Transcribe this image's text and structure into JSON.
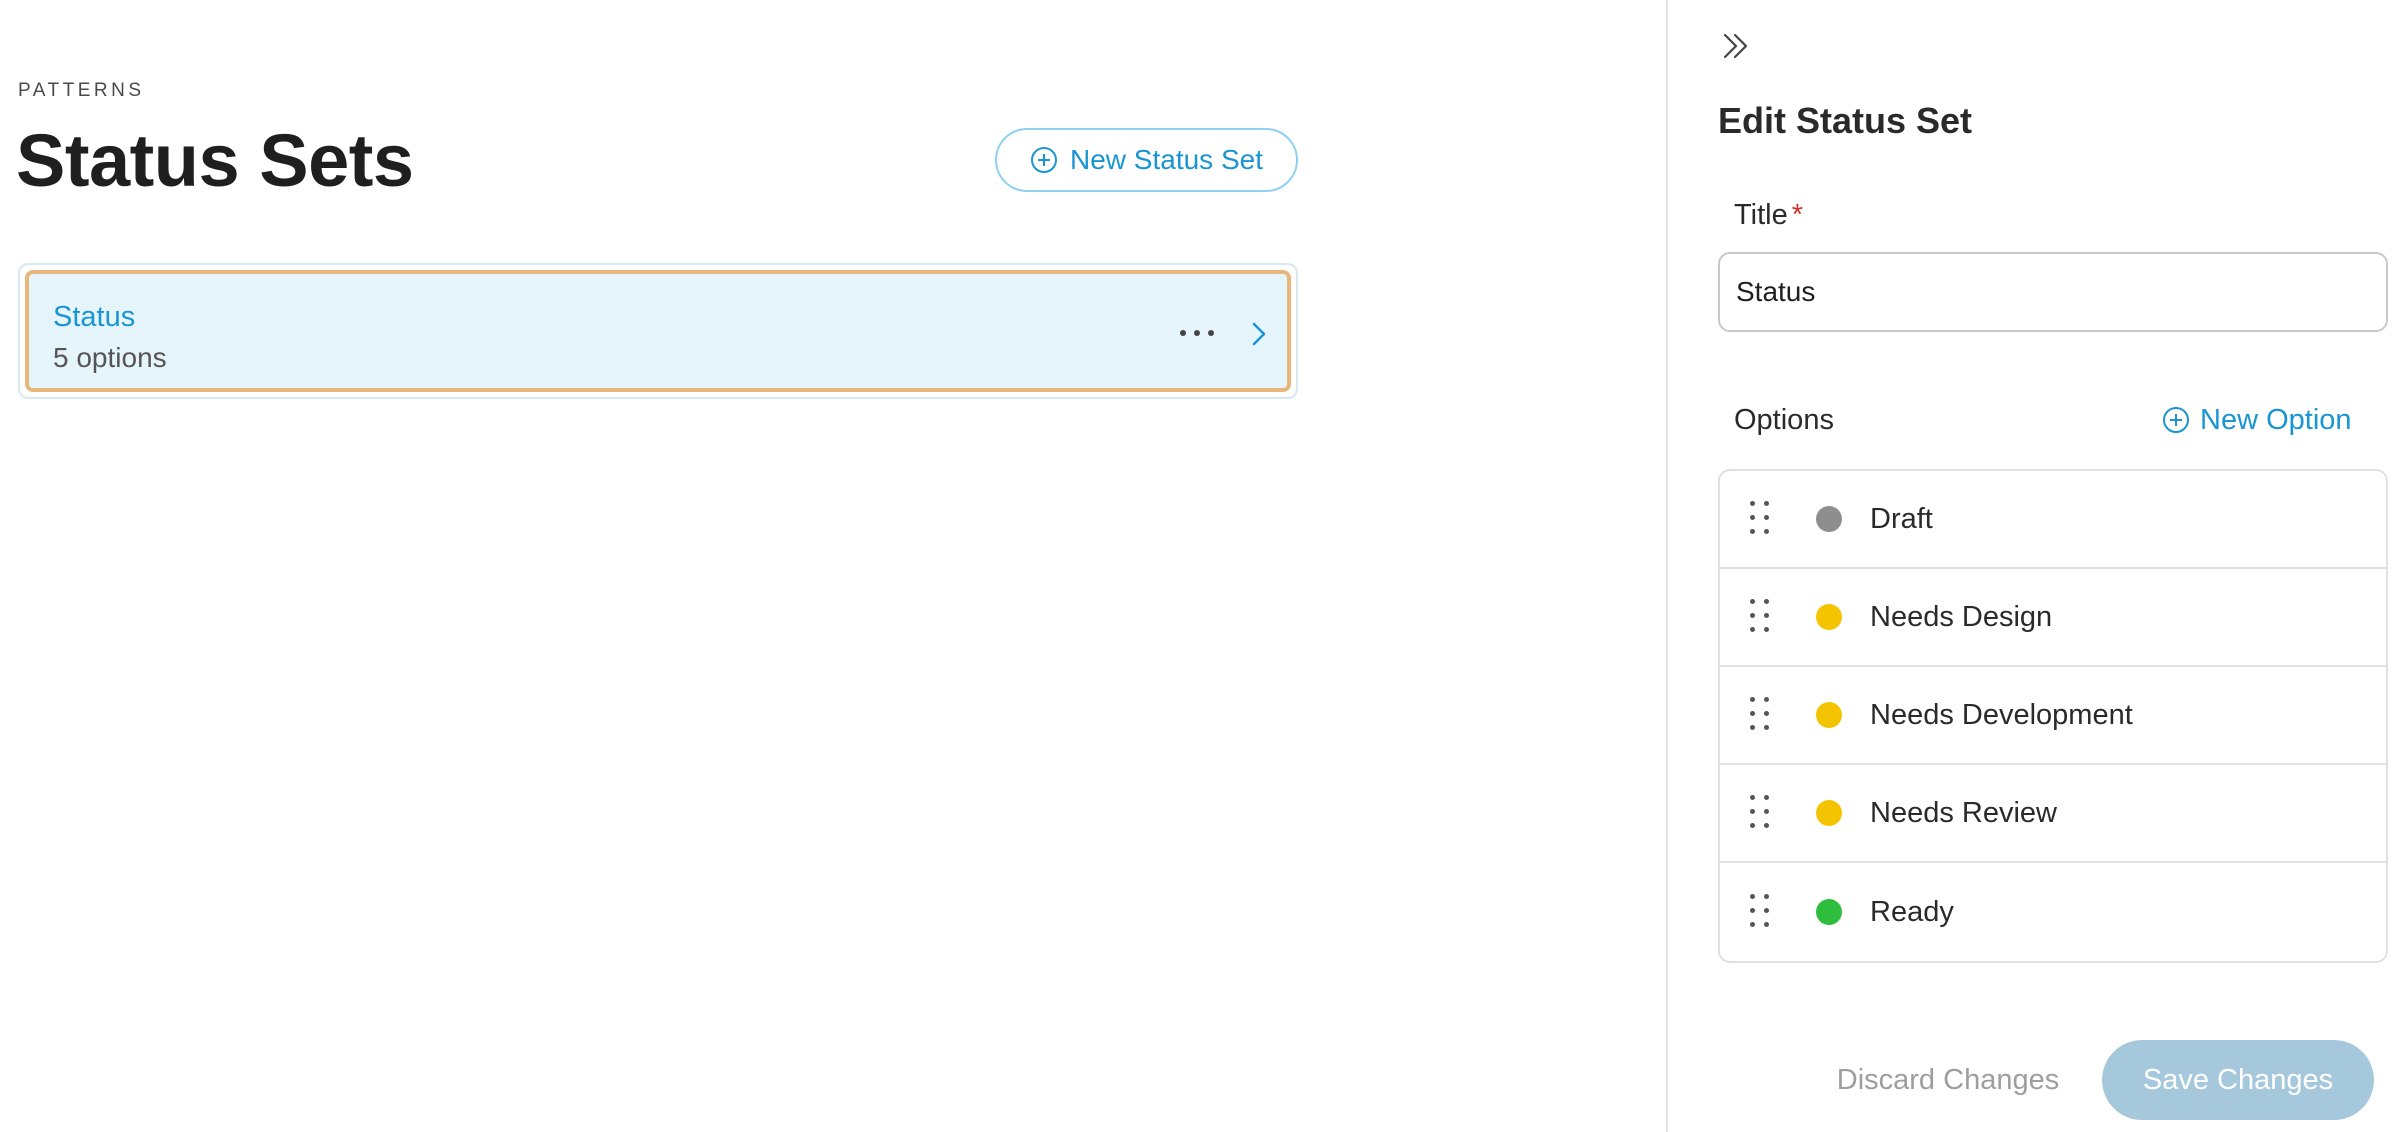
{
  "main": {
    "eyebrow": "PATTERNS",
    "title": "Status Sets",
    "new_set_label": "New Status Set",
    "sets": [
      {
        "title": "Status",
        "count_label": "5 options"
      }
    ]
  },
  "panel": {
    "title": "Edit Status Set",
    "title_field": {
      "label": "Title",
      "required_mark": "*",
      "value": "Status"
    },
    "options_label": "Options",
    "new_option_label": "New Option",
    "options": [
      {
        "label": "Draft",
        "color": "#8e8e8e"
      },
      {
        "label": "Needs Design",
        "color": "#f5c400"
      },
      {
        "label": "Needs Development",
        "color": "#f5c400"
      },
      {
        "label": "Needs Review",
        "color": "#f5c400"
      },
      {
        "label": "Ready",
        "color": "#2ebd3c"
      }
    ],
    "discard_label": "Discard Changes",
    "save_label": "Save Changes"
  },
  "colors": {
    "accent": "#1a95d3",
    "selected_card_bg": "#e6f5fc",
    "selected_card_border": "#e7b67a",
    "save_disabled_bg": "#a6c8dc",
    "required": "#d32f2f"
  },
  "icons": {
    "new_set": "plus-circle-icon",
    "more": "more-horizontal-icon",
    "open": "chevron-right-icon",
    "collapse": "double-chevron-right-icon",
    "drag": "drag-handle-icon"
  }
}
